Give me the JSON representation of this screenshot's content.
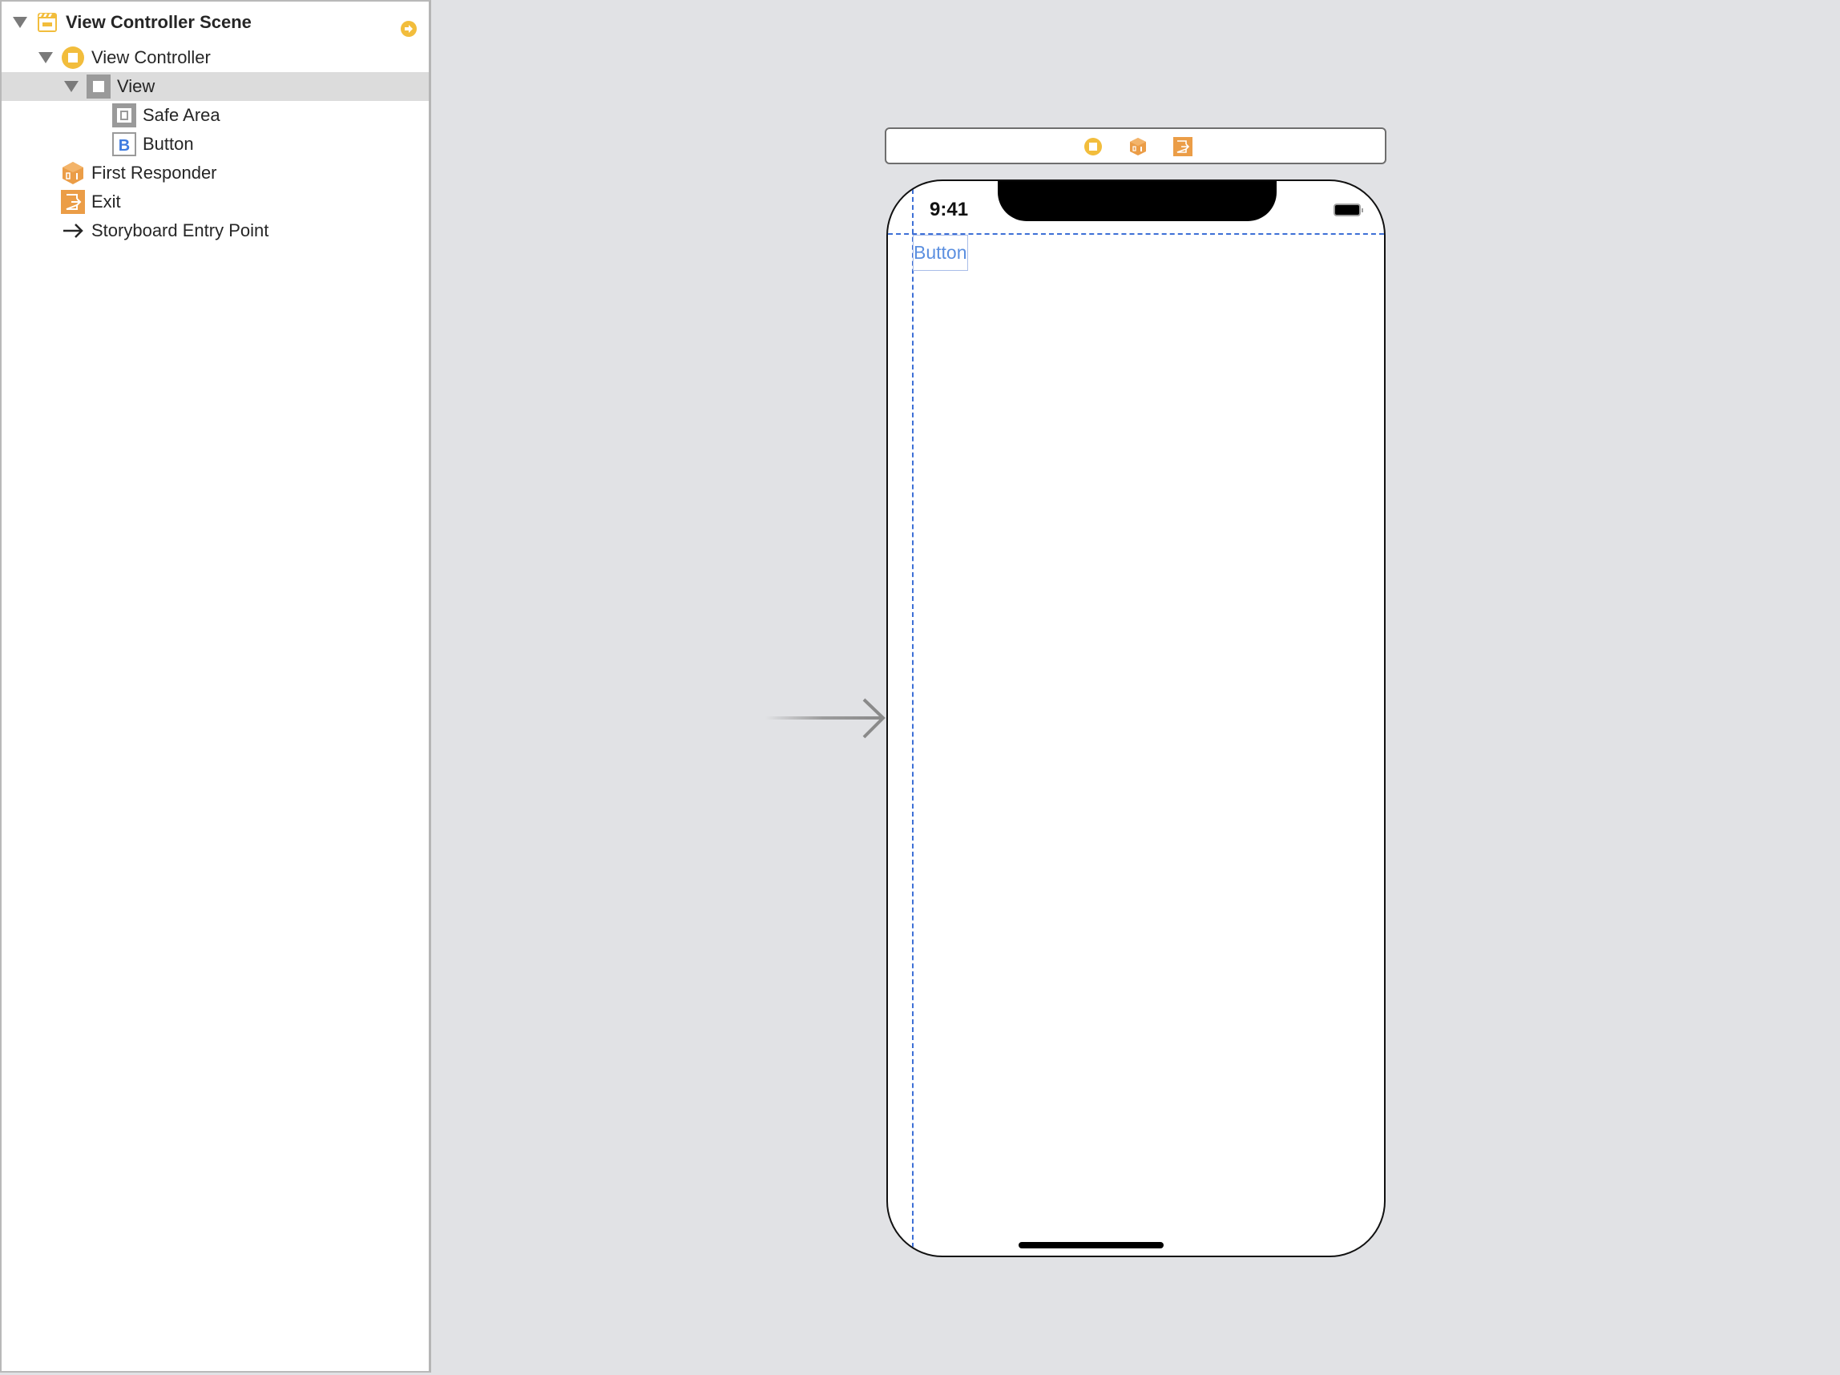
{
  "outline": {
    "scene": {
      "label": "View Controller Scene",
      "expanded": true
    },
    "items": [
      {
        "label": "View Controller",
        "icon": "view-controller-icon",
        "depth": 1,
        "expanded": true
      },
      {
        "label": "View",
        "icon": "view-icon",
        "depth": 2,
        "expanded": true,
        "selected": true
      },
      {
        "label": "Safe Area",
        "icon": "safe-area-icon",
        "depth": 3
      },
      {
        "label": "Button",
        "icon": "button-icon",
        "depth": 3,
        "glyph": "B"
      },
      {
        "label": "First Responder",
        "icon": "first-responder-icon",
        "depth": 1
      },
      {
        "label": "Exit",
        "icon": "exit-icon",
        "depth": 1
      },
      {
        "label": "Storyboard Entry Point",
        "icon": "entry-point-arrow-icon",
        "depth": 1
      }
    ]
  },
  "canvas": {
    "dock_icons": [
      "view-controller-icon",
      "first-responder-icon",
      "exit-icon"
    ],
    "device": {
      "status_time": "9:41",
      "button_label": "Button"
    }
  },
  "colors": {
    "accent_yellow": "#f2bd3c",
    "accent_orange": "#eb9d47",
    "button_text": "#5b8fe0",
    "guide_blue": "#3d6fd6",
    "selection": "#dcdcdc",
    "canvas_bg": "#e1e2e5"
  }
}
